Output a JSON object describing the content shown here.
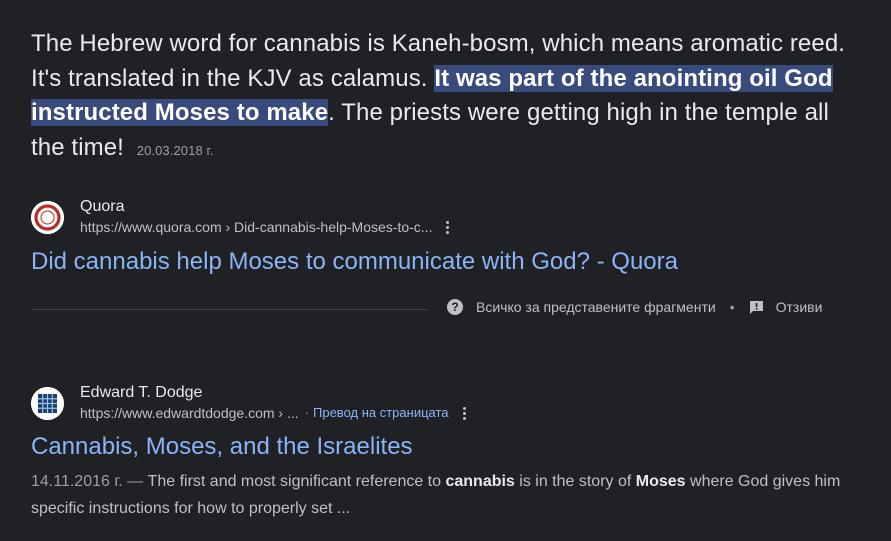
{
  "snippet": {
    "text_before": "The Hebrew word for cannabis is Kaneh-bosm, which means aromatic reed. It's translated in the KJV as calamus. ",
    "highlight": "It was part of the anointing oil God instructed Moses to make",
    "text_after": ". The priests were getting high in the temple all the time!",
    "date": "20.03.2018 г."
  },
  "result1": {
    "site_name": "Quora",
    "url": "https://www.quora.com › Did-cannabis-help-Moses-to-c...",
    "title": "Did cannabis help Moses to communicate with God? - Quora",
    "favicon": "quora-logo-icon"
  },
  "feedback": {
    "about_label": "Всичко за представените фрагменти",
    "bullet": "•",
    "feedback_label": "Отзиви"
  },
  "result2": {
    "site_name": "Edward T. Dodge",
    "url": "https://www.edwardtdodge.com › ...",
    "translate_sep": "·",
    "translate_label": "Превод на страницата",
    "title": "Cannabis, Moses, and the Israelites",
    "date": "14.11.2016 г. —",
    "desc_1": " The first and most significant reference to ",
    "desc_bold_1": "cannabis",
    "desc_2": " is in the story of ",
    "desc_bold_2": "Moses",
    "desc_3": " where God gives him specific instructions for how to properly set ...",
    "favicon": "grid-logo-icon"
  },
  "colors": {
    "background": "#202124",
    "link": "#8ab4f8",
    "highlight": "#394a7c",
    "quora_red": "#b92b27"
  }
}
